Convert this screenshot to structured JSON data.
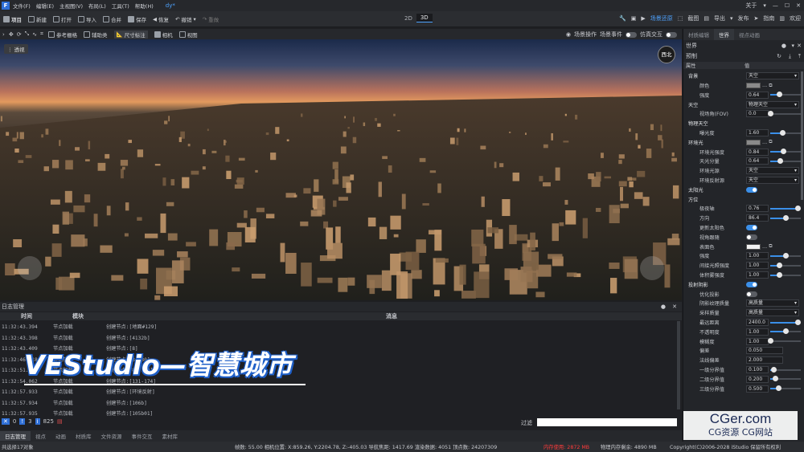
{
  "menubar": {
    "logo": "F",
    "items": [
      "文件(F)",
      "编辑(E)",
      "主视图(V)",
      "布局(L)",
      "工具(T)",
      "帮助(H)"
    ],
    "tag": "dy*",
    "right": [
      "关于",
      "▾",
      "—",
      "☐",
      "✕"
    ]
  },
  "toolbar": {
    "project": "项目",
    "items": [
      "新建",
      "打开",
      "导入",
      "合并",
      "保存",
      "恢复",
      "撤销",
      "重做"
    ],
    "modes": [
      "2D",
      "3D"
    ],
    "active_mode": "3D",
    "right": {
      "scene_restore": "场景还原",
      "screenshot": "截图",
      "export": "导出",
      "publish": "发布",
      "guide": "指南",
      "welcome": "欢迎"
    }
  },
  "viewbar": {
    "items": [
      "参考栅格",
      "辅助类",
      "尺寸标注",
      "相机",
      "视图"
    ],
    "right": {
      "scene_op": "场景操作",
      "scene_event": "场景事件",
      "sim": "仿真交互"
    }
  },
  "viewport": {
    "tag": "透视",
    "compass": "西北"
  },
  "overlay": {
    "title": "VEStudio—智慧城市"
  },
  "rightpanel": {
    "tabs": [
      "材质编辑",
      "世界",
      "视点动画"
    ],
    "active_tab": "世界",
    "section": "世界",
    "preset": "预制",
    "col_attr": "属性",
    "col_val": "值"
  },
  "props": [
    {
      "label": "背景",
      "group": true,
      "type": "select",
      "value": "天空"
    },
    {
      "label": "颜色",
      "type": "color"
    },
    {
      "label": "强度",
      "type": "slider",
      "value": "0.64",
      "pct": 0.3
    },
    {
      "label": "天空",
      "group": true,
      "type": "select",
      "value": "物理天空"
    },
    {
      "label": "视场角(FOV)",
      "type": "slider",
      "value": "0.0",
      "pct": 0.0
    },
    {
      "label": "物理天空",
      "group": true,
      "type": "none"
    },
    {
      "label": "曝光度",
      "type": "slider",
      "value": "1.60",
      "pct": 0.4
    },
    {
      "label": "环境光",
      "group": true,
      "type": "color"
    },
    {
      "label": "环境光强度",
      "type": "slider",
      "value": "0.84",
      "pct": 0.42
    },
    {
      "label": "天光分量",
      "type": "slider",
      "value": "0.64",
      "pct": 0.32
    },
    {
      "label": "环境光源",
      "type": "select",
      "value": "天空"
    },
    {
      "label": "环境反射源",
      "type": "select",
      "value": "天空"
    },
    {
      "label": "太阳光",
      "group": true,
      "type": "toggle",
      "on": true
    },
    {
      "label": "方位",
      "group": true,
      "type": "none"
    },
    {
      "label": "极夜轴",
      "type": "slider",
      "value": "0.76",
      "pct": 0.9
    },
    {
      "label": "方向",
      "type": "slider",
      "value": "86.4",
      "pct": 0.5
    },
    {
      "label": "更新太阳色",
      "type": "toggle",
      "on": true
    },
    {
      "label": "视角跟随",
      "type": "toggle",
      "on": false
    },
    {
      "label": "表面色",
      "type": "color"
    },
    {
      "label": "强度",
      "type": "slider",
      "value": "1.00",
      "pct": 0.5
    },
    {
      "label": "间接光照强度",
      "type": "slider",
      "value": "1.00",
      "pct": 0.3
    },
    {
      "label": "体积雾强度",
      "type": "slider",
      "value": "1.00",
      "pct": 0.3
    },
    {
      "label": "投射阴影",
      "group": true,
      "type": "toggle",
      "on": true
    },
    {
      "label": "优化投影",
      "type": "toggle",
      "on": false
    },
    {
      "label": "阴影纹理质量",
      "type": "select",
      "value": "高质量"
    },
    {
      "label": "采样质量",
      "type": "select",
      "value": "高质量"
    },
    {
      "label": "最远距离",
      "type": "slider",
      "value": "2400.0",
      "pct": 0.9
    },
    {
      "label": "不透明度",
      "type": "slider",
      "value": "1.00",
      "pct": 0.5
    },
    {
      "label": "模糊度",
      "type": "slider",
      "value": "1.00",
      "pct": 0.0
    },
    {
      "label": "偏差",
      "type": "num",
      "value": "0.050"
    },
    {
      "label": "法线偏差",
      "type": "num",
      "value": "2.000"
    },
    {
      "label": "一级分界值",
      "type": "slider",
      "value": "0.100",
      "pct": 0.1
    },
    {
      "label": "二级分界值",
      "type": "slider",
      "value": "0.200",
      "pct": 0.15
    },
    {
      "label": "三级分界值",
      "type": "slider",
      "value": "0.500",
      "pct": 0.25
    }
  ],
  "log": {
    "title": "日志管理",
    "columns": [
      "时间",
      "模块",
      "消息"
    ],
    "rows": [
      [
        "11:32:43.394",
        "节点加载",
        "创建节点:[地面#129]"
      ],
      [
        "11:32:43.398",
        "节点加载",
        "创建节点:[4132b]"
      ],
      [
        "11:32:43.409",
        "节点加载",
        "创建节点:[8]"
      ],
      [
        "11:32:46.618",
        "节点加载",
        "创建节点:[34-80]"
      ],
      [
        "11:32:51.605",
        "节点加载",
        "创建节点:[81-130]"
      ],
      [
        "11:32:54.062",
        "节点加载",
        "创建节点:[131-174]"
      ],
      [
        "11:32:57.933",
        "节点加载",
        "创建节点:[环境反射]"
      ],
      [
        "11:32:57.934",
        "节点加载",
        "创建节点:[106b]"
      ],
      [
        "11:32:57.935",
        "节点加载",
        "创建节点:[105b01]"
      ]
    ],
    "counts": {
      "errors": "0",
      "warnings": "3",
      "info": "825"
    },
    "filter_label": "过滤"
  },
  "bottomtabs": [
    "日志管理",
    "视点",
    "动画",
    "材质库",
    "文件资源",
    "事件交互",
    "素材库"
  ],
  "status": {
    "left": "共选择17对象",
    "right": "帧数: 55.00 相机位置: X:859.26, Y:2204.78, Z:-405.03 导航焦距: 1417.69 渲染数据: 4051 顶点数: 24207309",
    "mem": "内存使用: 2872 MB",
    "mem2": "物理内存剩余: 4890 MB",
    "copy": "Copyright(C)2006-2028 iStudio 保留所有权利"
  },
  "watermark": {
    "l1": "CGer.com",
    "l2": "CG资源 CG网站"
  },
  "colors": {
    "accent": "#3b8fe8",
    "error": "#ff3b3b"
  }
}
